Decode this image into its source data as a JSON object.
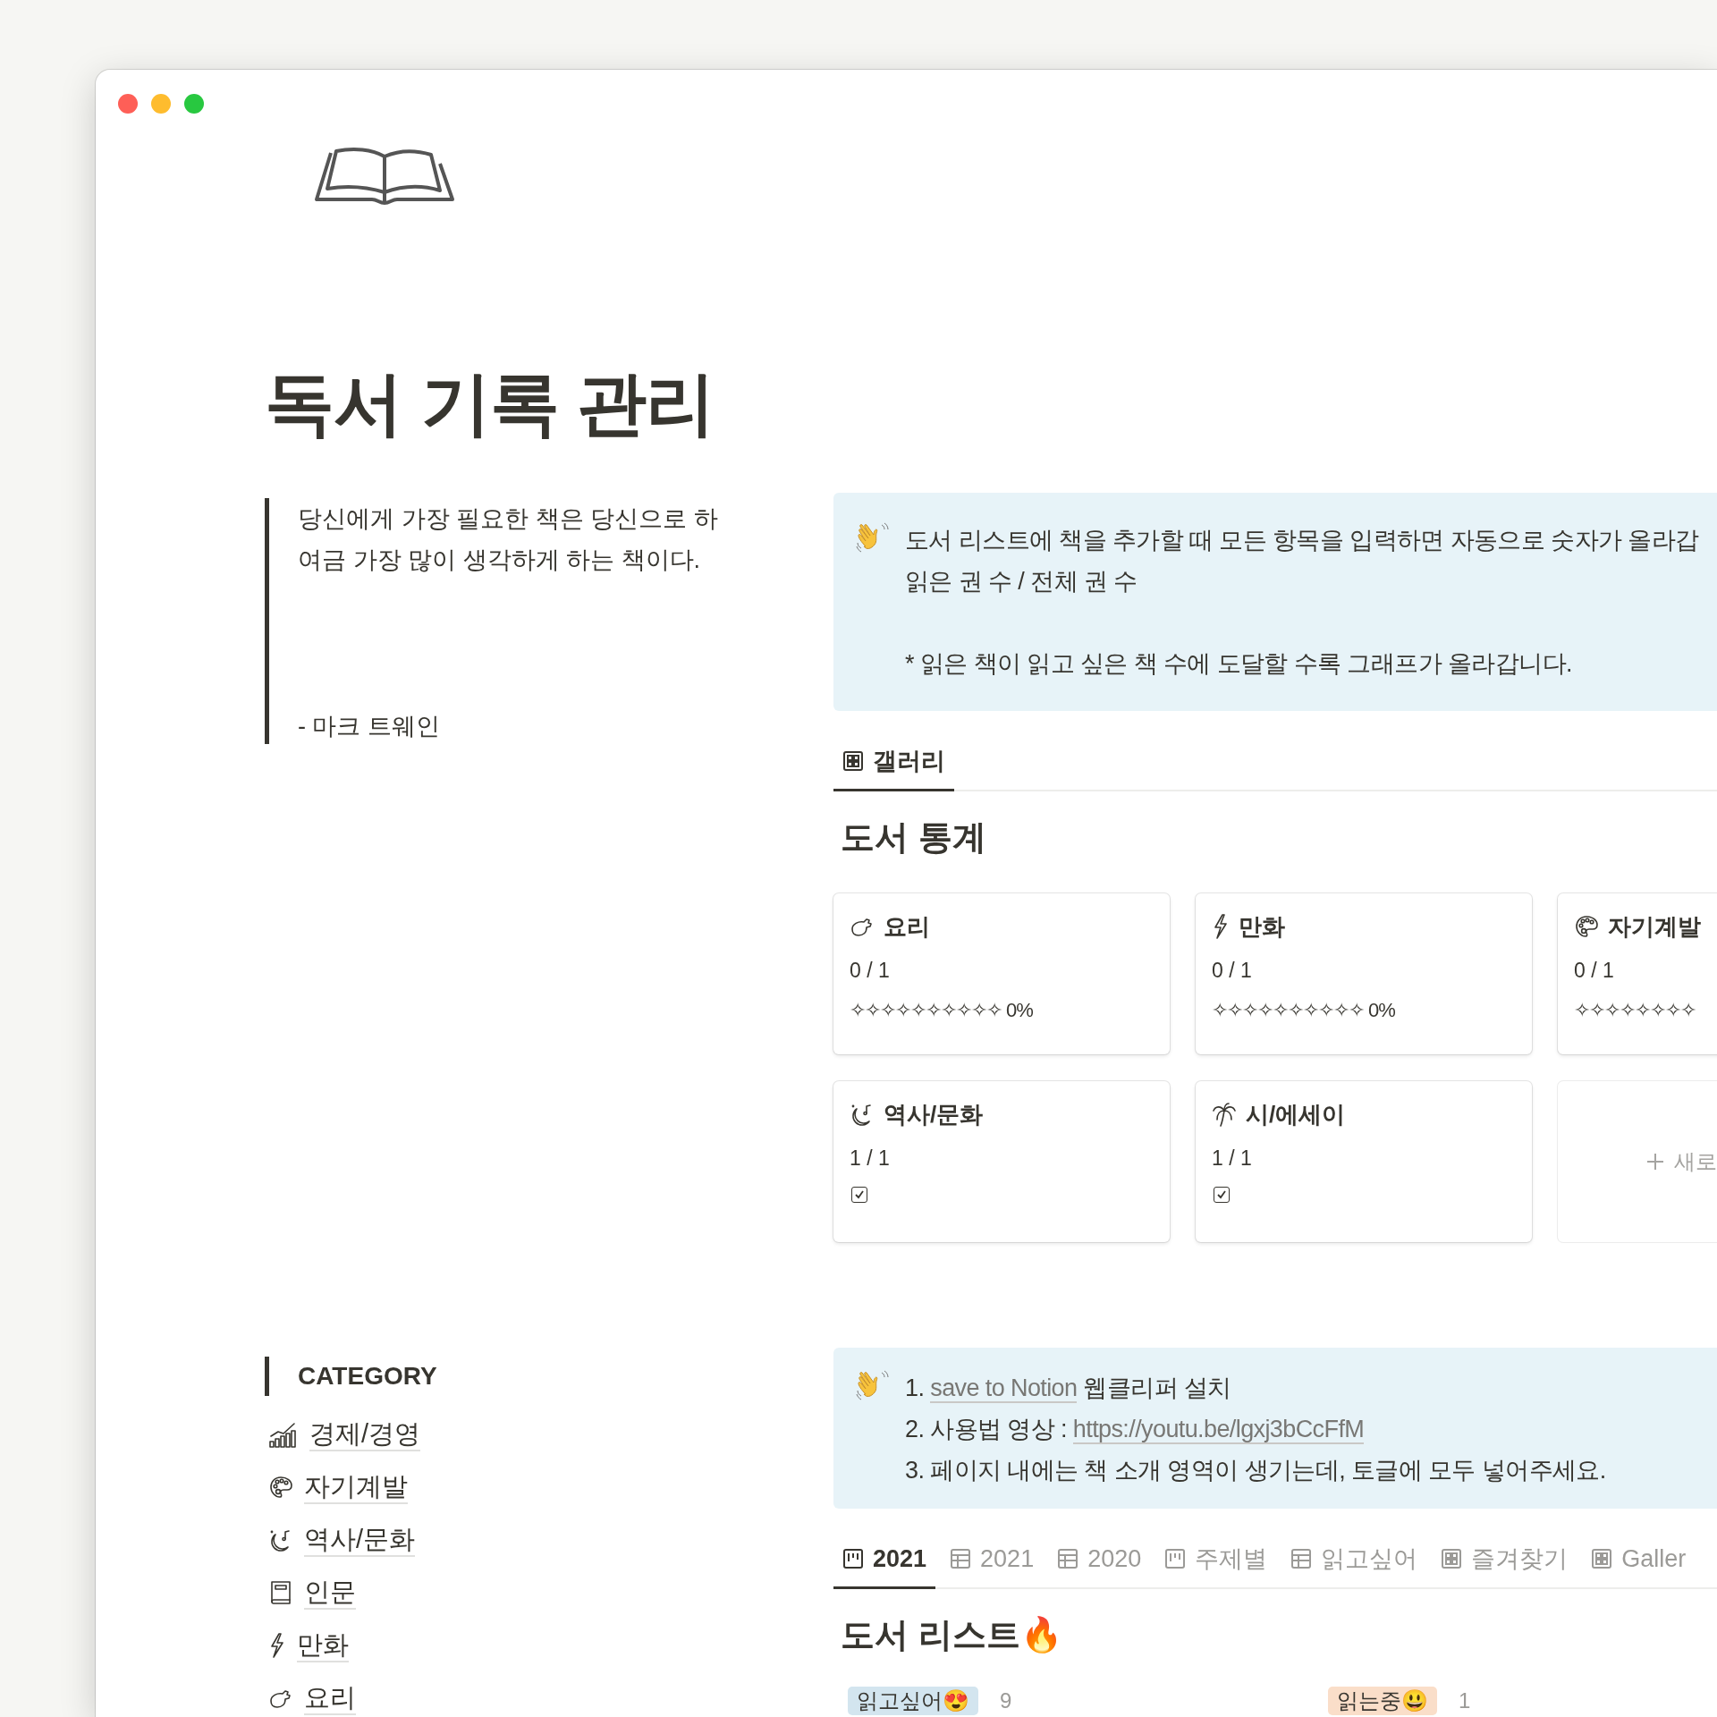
{
  "page": {
    "title": "독서 기록 관리"
  },
  "quote": {
    "text": "당신에게 가장 필요한 책은 당신으로 하여금 가장 많이 생각하게 하는 책이다.",
    "author": "- 마크 트웨인"
  },
  "callout": {
    "lines": [
      "도서 리스트에 책을 추가할 때 모든 항목을 입력하면 자동으로 숫자가 올라갑",
      "읽은 권 수 / 전체 권 수"
    ],
    "note": "* 읽은 책이 읽고 싶은 책 수에 도달할 수록 그래프가 올라갑니다."
  },
  "gallery_tabs": [
    {
      "kind": "gallery",
      "label": "갤러리",
      "selected": true
    }
  ],
  "stats": {
    "title": "도서 통계",
    "cards": [
      {
        "kind": "progress",
        "title": "요리",
        "count": "0 / 1",
        "progress": "✧✧✧✧✧✧✧✧✧✧ 0%"
      },
      {
        "kind": "progress",
        "title": "만화",
        "count": "0 / 1",
        "progress": "✧✧✧✧✧✧✧✧✧✧ 0%"
      },
      {
        "kind": "progress",
        "title": "자기계발",
        "count": "0 / 1",
        "progress": "✧✧✧✧✧✧✧✧"
      },
      {
        "kind": "done",
        "title": "역사/문화",
        "count": "1 / 1",
        "checked": true
      },
      {
        "kind": "done",
        "title": "시/에세이",
        "count": "1 / 1",
        "checked": true
      }
    ],
    "new_card": "새로"
  },
  "category": {
    "title": "CATEGORY",
    "items": [
      "경제/경영",
      "자기계발",
      "역사/문화",
      "인문",
      "만화",
      "요리"
    ]
  },
  "callout2": {
    "lines": [
      {
        "text": "1. ",
        "link": "save to Notion",
        "after": " 웹클리퍼 설치"
      },
      {
        "text": "2. 사용법 영상 : ",
        "link": "https://youtu.be/lgxj3bCcFfM"
      },
      {
        "text": "3. 페이지 내에는 책 소개 영역이 생기는데, 토글에 모두 넣어주세요."
      }
    ]
  },
  "list_tabs": [
    {
      "kind": "board",
      "label": "2021",
      "selected": true
    },
    {
      "kind": "table",
      "label": "2021",
      "selected": false
    },
    {
      "kind": "table",
      "label": "2020",
      "selected": false
    },
    {
      "kind": "board",
      "label": "주제별",
      "selected": false
    },
    {
      "kind": "table",
      "label": "읽고싶어",
      "selected": false
    },
    {
      "kind": "gallery",
      "label": "즐겨찾기",
      "selected": false
    },
    {
      "kind": "gallery",
      "label": "Galler",
      "selected": false
    }
  ],
  "list": {
    "title": "도서 리스트🔥",
    "groups": [
      {
        "label": "읽고싶어😍",
        "color": "#d3e5ef",
        "count": "9"
      },
      {
        "label": "읽는중😃",
        "color": "#fadec9",
        "count": "1"
      }
    ]
  }
}
